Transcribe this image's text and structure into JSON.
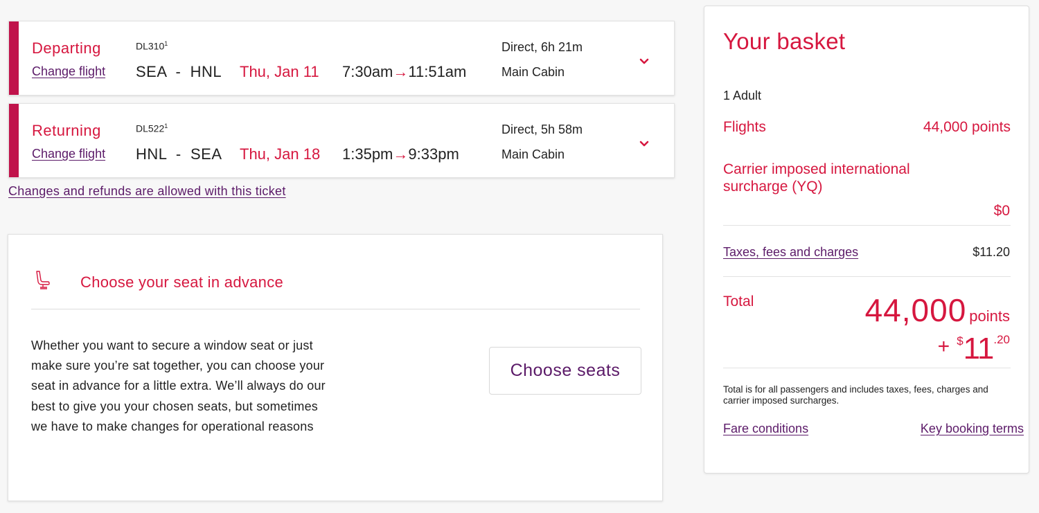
{
  "colors": {
    "brand_red": "#d6173f",
    "accent_bar": "#c0134b",
    "link_purple": "#5b1a68",
    "background": "#f7f7f7"
  },
  "flights": [
    {
      "direction": "Departing",
      "change_label": "Change flight",
      "flight_number": "DL310",
      "footnote": "1",
      "route": "SEA  -  HNL",
      "date": "Thu, Jan 11",
      "depart_time": "7:30am",
      "arrow": "→",
      "arrive_time": "11:51am",
      "duration": "Direct, 6h 21m",
      "cabin": "Main Cabin",
      "expand_icon": "chevron-down-icon"
    },
    {
      "direction": "Returning",
      "change_label": "Change flight",
      "flight_number": "DL522",
      "footnote": "1",
      "route": "HNL  -  SEA",
      "date": "Thu, Jan 18",
      "depart_time": "1:35pm",
      "arrow": "→",
      "arrive_time": "9:33pm",
      "duration": "Direct, 5h 58m",
      "cabin": "Main Cabin",
      "expand_icon": "chevron-down-icon"
    }
  ],
  "changes_link": "Changes and refunds are allowed with this ticket",
  "seat_section": {
    "icon": "seat-icon",
    "title": "Choose your seat in advance",
    "description": "Whether you want to secure a window seat or just make sure you’re sat together, you can choose your seat in advance for a little extra. We’ll always do our best to give you your chosen seats, but sometimes we have to make changes for operational reasons",
    "button_label": "Choose seats"
  },
  "basket": {
    "title": "Your basket",
    "passengers": "1 Adult",
    "flights_label": "Flights",
    "flights_value": "44,000 points",
    "surcharge_label": "Carrier imposed international surcharge (YQ)",
    "surcharge_value": "$0",
    "taxes_label": "Taxes, fees and charges",
    "taxes_value": "$11.20",
    "total_label": "Total",
    "total_points": "44,000",
    "total_points_unit": "points",
    "total_plus": "+",
    "total_currency": "$",
    "total_cash_whole": "11",
    "total_cash_cents": ".20",
    "note": "Total is for all passengers and includes taxes, fees, charges and carrier imposed surcharges.",
    "fare_conditions_link": "Fare conditions",
    "key_terms_link": "Key booking terms"
  }
}
